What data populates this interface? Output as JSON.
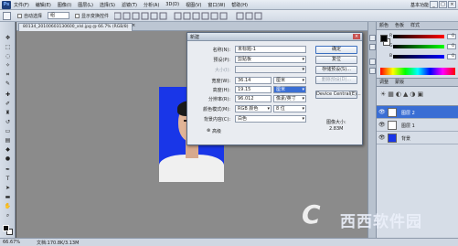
{
  "menubar": {
    "logo": "Ps",
    "items": [
      "文件(F)",
      "编辑(E)",
      "图像(I)",
      "图层(L)",
      "选择(S)",
      "滤镜(T)",
      "分析(A)",
      "3D(D)",
      "视图(V)",
      "窗口(W)",
      "帮助(H)"
    ],
    "workspace": "基本功能",
    "win_min": "_",
    "win_max": "□",
    "win_close": "×"
  },
  "options": {
    "auto_select_label": "自动选择",
    "auto_select_value": "组",
    "show_transform_label": "显示变换控件"
  },
  "document": {
    "tab_title": "80134_20100603130600_xlsl.jpg @ 66.7% (RGB/8)",
    "tab_close": "×"
  },
  "statusbar": {
    "zoom": "66.67%",
    "doc_info": "文档:170.8K/3.13M"
  },
  "color_panel": {
    "tabs": [
      "颜色",
      "色板",
      "样式"
    ],
    "sliders": [
      {
        "label": "R",
        "value": "0"
      },
      {
        "label": "G",
        "value": "0"
      },
      {
        "label": "B",
        "value": "0"
      }
    ]
  },
  "adjust_panel": {
    "tabs": [
      "调整",
      "蒙版"
    ]
  },
  "layers_panel": {
    "layers": [
      {
        "name": "图层 2"
      },
      {
        "name": "图层 1"
      },
      {
        "name": "背景"
      }
    ]
  },
  "dialog": {
    "title": "新建",
    "close": "×",
    "fields": {
      "name_label": "名称(N):",
      "name_value": "未标题-1",
      "preset_label": "预设(P):",
      "preset_value": "剪贴板",
      "size_label": "大小(I):",
      "size_value": "",
      "width_label": "宽度(W):",
      "width_value": "36.14",
      "width_unit": "厘米",
      "height_label": "高度(H):",
      "height_value": "19.15",
      "height_unit": "厘米",
      "resolution_label": "分辨率(R):",
      "resolution_value": "96.012",
      "resolution_unit": "像素/英寸",
      "color_mode_label": "颜色模式(M):",
      "color_mode_value": "RGB 颜色",
      "bit_depth": "8 位",
      "background_label": "背景内容(C):",
      "background_value": "白色",
      "advanced_label": "高级"
    },
    "buttons": {
      "ok": "确定",
      "cancel": "复位",
      "save_preset": "存储预设(S)...",
      "delete_preset": "删除预设(D)...",
      "device_central": "Device Central(E)..."
    },
    "image_size_label": "图像大小:",
    "image_size_value": "2.83M"
  },
  "watermark": {
    "logo_letter": "C",
    "text": "西西软件园"
  }
}
